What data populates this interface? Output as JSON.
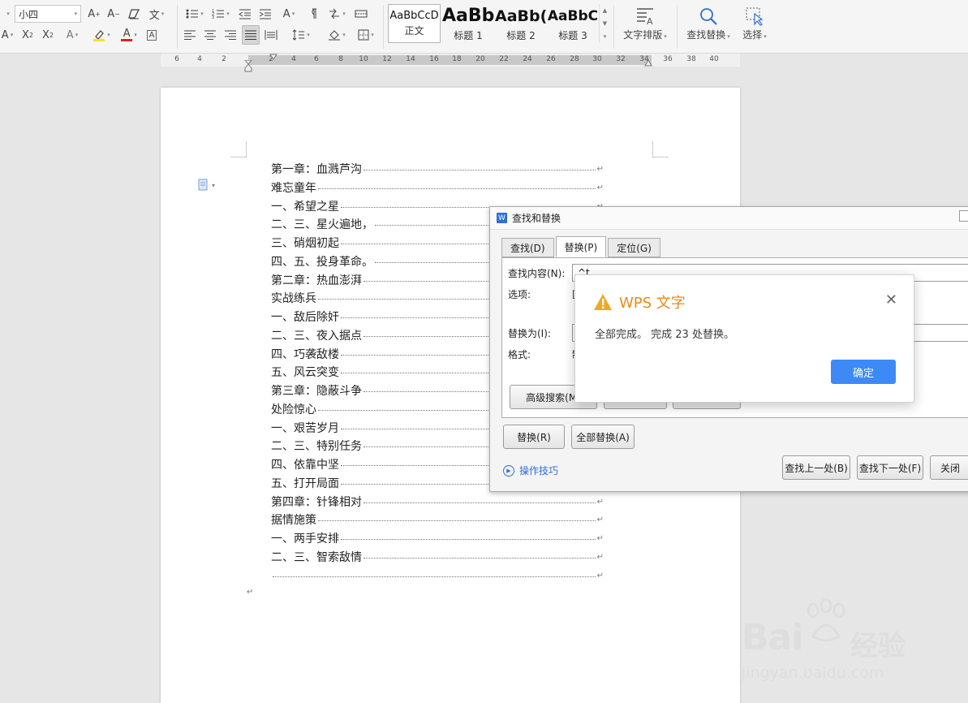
{
  "ribbon": {
    "font_size": "小四",
    "styles": [
      {
        "preview": "AaBbCcD",
        "caption": "正文"
      },
      {
        "preview": "AaBb",
        "caption": "标题 1"
      },
      {
        "preview": "AaBb(",
        "caption": "标题 2"
      },
      {
        "preview": "AaBbC",
        "caption": "标题 3"
      }
    ],
    "text_layout_label": "文字排版",
    "find_replace_label": "查找替换",
    "select_label": "选择"
  },
  "ruler": {
    "ticks": [
      "6",
      "4",
      "2",
      "2",
      "4",
      "6",
      "8",
      "10",
      "12",
      "14",
      "16",
      "18",
      "20",
      "22",
      "24",
      "26",
      "28",
      "30",
      "32",
      "34",
      "36",
      "38",
      "40"
    ]
  },
  "document": {
    "toc": [
      "第一章：血溅芦沟",
      "难忘童年",
      "一、希望之星",
      "二、三、星火遍地，",
      "三、硝烟初起",
      "四、五、投身革命。",
      "第二章：热血澎湃",
      "实战练兵",
      "一、敌后除奸",
      "二、三、夜入据点",
      "四、巧袭敌楼",
      "五、风云突变",
      "第三章：隐蔽斗争",
      "处险惊心",
      "一、艰苦岁月",
      "二、三、特别任务",
      "四、依靠中坚",
      "五、打开局面",
      "第四章：针锋相对",
      "据情施策",
      "一、两手安排",
      "二、三、智索敌情",
      ""
    ],
    "return_mark": "↵"
  },
  "find_dialog": {
    "title": "查找和替换",
    "tabs": [
      "查找(D)",
      "替换(P)",
      "定位(G)"
    ],
    "active_tab": "替换(P)",
    "find_label": "查找内容(N):",
    "find_value": "^t",
    "options_label": "选项:",
    "options_value": "区",
    "replace_label": "替换为(I):",
    "format_label": "格式:",
    "format_value": "制",
    "advanced_button": "高级搜索(M)",
    "replace_button": "替换(R)",
    "replace_all_button": "全部替换(A)",
    "tips_link": "操作技巧",
    "find_prev_button": "查找上一处(B)",
    "find_next_button": "查找下一处(F)",
    "close_button": "关闭"
  },
  "message_box": {
    "title": "WPS 文字",
    "message": "全部完成。 完成 23 处替换。",
    "ok_button": "确定"
  },
  "watermark": {
    "brand": "Bai",
    "brand_suffix": "经验",
    "url": "jingyan.baidu.com"
  },
  "colors": {
    "accent_blue": "#3d8af7",
    "warning_orange": "#e88b1a",
    "link_blue": "#2e6fd7"
  }
}
